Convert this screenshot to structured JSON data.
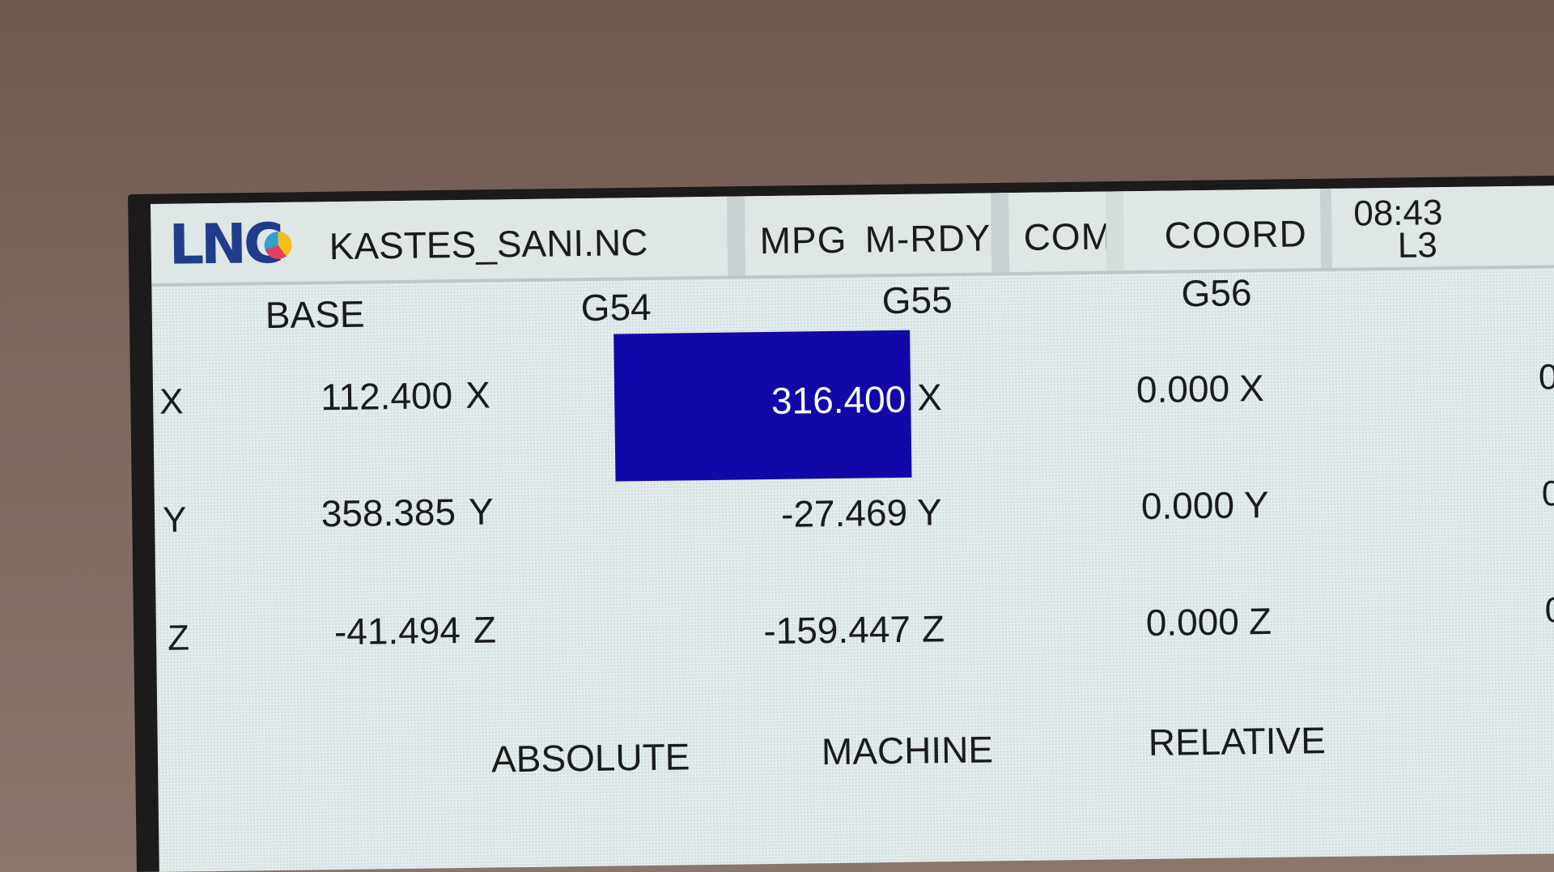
{
  "header": {
    "logo": "LNC",
    "filename": "KASTES_SANI.NC",
    "mode": "MPG",
    "status": "M-RDY",
    "com": "COM",
    "page": "COORD",
    "time": "08:43",
    "line": "L3"
  },
  "columns": [
    "BASE",
    "G54",
    "G55",
    "G56"
  ],
  "axes": [
    "X",
    "Y",
    "Z"
  ],
  "base": [
    "112.400",
    "358.385",
    "-41.494"
  ],
  "g54": [
    "316.400",
    "-27.469",
    "-159.447"
  ],
  "g55": [
    "0.000",
    "0.000",
    "0.000"
  ],
  "g56_partial": [
    "0",
    "0",
    "0"
  ],
  "bottom_tabs": [
    "ABSOLUTE",
    "MACHINE",
    "RELATIVE"
  ],
  "colors": {
    "selection": "#1208a8",
    "logo": "#1f3d8c"
  }
}
